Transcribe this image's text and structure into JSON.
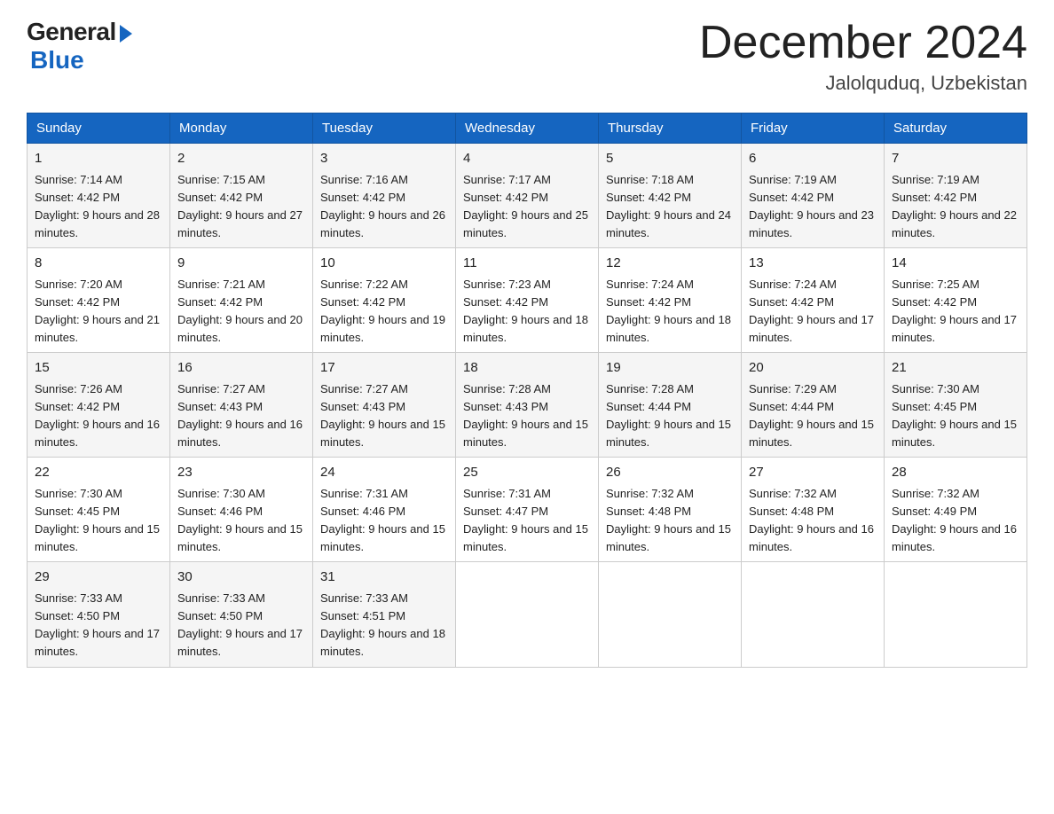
{
  "logo": {
    "general": "General",
    "blue": "Blue"
  },
  "title": "December 2024",
  "location": "Jalolquduq, Uzbekistan",
  "headers": [
    "Sunday",
    "Monday",
    "Tuesday",
    "Wednesday",
    "Thursday",
    "Friday",
    "Saturday"
  ],
  "weeks": [
    [
      {
        "day": "1",
        "sunrise": "7:14 AM",
        "sunset": "4:42 PM",
        "daylight": "9 hours and 28 minutes."
      },
      {
        "day": "2",
        "sunrise": "7:15 AM",
        "sunset": "4:42 PM",
        "daylight": "9 hours and 27 minutes."
      },
      {
        "day": "3",
        "sunrise": "7:16 AM",
        "sunset": "4:42 PM",
        "daylight": "9 hours and 26 minutes."
      },
      {
        "day": "4",
        "sunrise": "7:17 AM",
        "sunset": "4:42 PM",
        "daylight": "9 hours and 25 minutes."
      },
      {
        "day": "5",
        "sunrise": "7:18 AM",
        "sunset": "4:42 PM",
        "daylight": "9 hours and 24 minutes."
      },
      {
        "day": "6",
        "sunrise": "7:19 AM",
        "sunset": "4:42 PM",
        "daylight": "9 hours and 23 minutes."
      },
      {
        "day": "7",
        "sunrise": "7:19 AM",
        "sunset": "4:42 PM",
        "daylight": "9 hours and 22 minutes."
      }
    ],
    [
      {
        "day": "8",
        "sunrise": "7:20 AM",
        "sunset": "4:42 PM",
        "daylight": "9 hours and 21 minutes."
      },
      {
        "day": "9",
        "sunrise": "7:21 AM",
        "sunset": "4:42 PM",
        "daylight": "9 hours and 20 minutes."
      },
      {
        "day": "10",
        "sunrise": "7:22 AM",
        "sunset": "4:42 PM",
        "daylight": "9 hours and 19 minutes."
      },
      {
        "day": "11",
        "sunrise": "7:23 AM",
        "sunset": "4:42 PM",
        "daylight": "9 hours and 18 minutes."
      },
      {
        "day": "12",
        "sunrise": "7:24 AM",
        "sunset": "4:42 PM",
        "daylight": "9 hours and 18 minutes."
      },
      {
        "day": "13",
        "sunrise": "7:24 AM",
        "sunset": "4:42 PM",
        "daylight": "9 hours and 17 minutes."
      },
      {
        "day": "14",
        "sunrise": "7:25 AM",
        "sunset": "4:42 PM",
        "daylight": "9 hours and 17 minutes."
      }
    ],
    [
      {
        "day": "15",
        "sunrise": "7:26 AM",
        "sunset": "4:42 PM",
        "daylight": "9 hours and 16 minutes."
      },
      {
        "day": "16",
        "sunrise": "7:27 AM",
        "sunset": "4:43 PM",
        "daylight": "9 hours and 16 minutes."
      },
      {
        "day": "17",
        "sunrise": "7:27 AM",
        "sunset": "4:43 PM",
        "daylight": "9 hours and 15 minutes."
      },
      {
        "day": "18",
        "sunrise": "7:28 AM",
        "sunset": "4:43 PM",
        "daylight": "9 hours and 15 minutes."
      },
      {
        "day": "19",
        "sunrise": "7:28 AM",
        "sunset": "4:44 PM",
        "daylight": "9 hours and 15 minutes."
      },
      {
        "day": "20",
        "sunrise": "7:29 AM",
        "sunset": "4:44 PM",
        "daylight": "9 hours and 15 minutes."
      },
      {
        "day": "21",
        "sunrise": "7:30 AM",
        "sunset": "4:45 PM",
        "daylight": "9 hours and 15 minutes."
      }
    ],
    [
      {
        "day": "22",
        "sunrise": "7:30 AM",
        "sunset": "4:45 PM",
        "daylight": "9 hours and 15 minutes."
      },
      {
        "day": "23",
        "sunrise": "7:30 AM",
        "sunset": "4:46 PM",
        "daylight": "9 hours and 15 minutes."
      },
      {
        "day": "24",
        "sunrise": "7:31 AM",
        "sunset": "4:46 PM",
        "daylight": "9 hours and 15 minutes."
      },
      {
        "day": "25",
        "sunrise": "7:31 AM",
        "sunset": "4:47 PM",
        "daylight": "9 hours and 15 minutes."
      },
      {
        "day": "26",
        "sunrise": "7:32 AM",
        "sunset": "4:48 PM",
        "daylight": "9 hours and 15 minutes."
      },
      {
        "day": "27",
        "sunrise": "7:32 AM",
        "sunset": "4:48 PM",
        "daylight": "9 hours and 16 minutes."
      },
      {
        "day": "28",
        "sunrise": "7:32 AM",
        "sunset": "4:49 PM",
        "daylight": "9 hours and 16 minutes."
      }
    ],
    [
      {
        "day": "29",
        "sunrise": "7:33 AM",
        "sunset": "4:50 PM",
        "daylight": "9 hours and 17 minutes."
      },
      {
        "day": "30",
        "sunrise": "7:33 AM",
        "sunset": "4:50 PM",
        "daylight": "9 hours and 17 minutes."
      },
      {
        "day": "31",
        "sunrise": "7:33 AM",
        "sunset": "4:51 PM",
        "daylight": "9 hours and 18 minutes."
      },
      null,
      null,
      null,
      null
    ]
  ]
}
